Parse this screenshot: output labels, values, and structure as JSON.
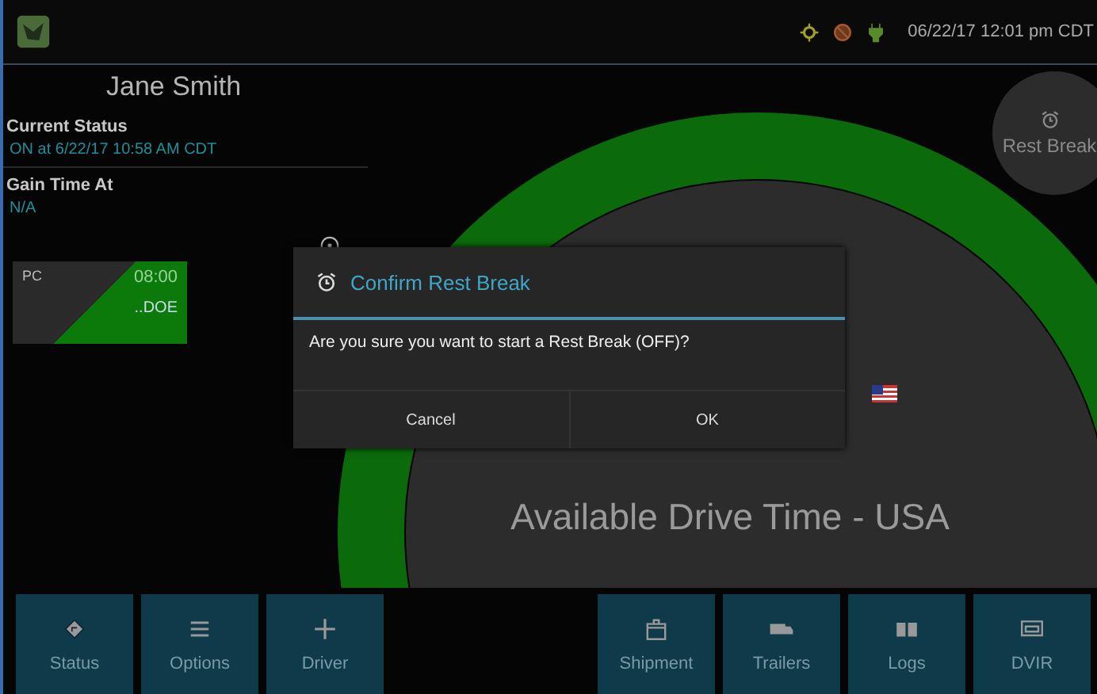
{
  "top_bar": {
    "datetime": "06/22/17 12:01 pm CDT"
  },
  "driver": {
    "name": "Jane Smith"
  },
  "current_status": {
    "label": "Current Status",
    "value": "ON at 6/22/17 10:58 AM CDT"
  },
  "gain_time": {
    "label": "Gain Time At",
    "value": "N/A"
  },
  "status_card": {
    "status": "PC",
    "time": "08:00",
    "driver": "..DOE"
  },
  "rest_break_button": {
    "label": "Rest Break"
  },
  "gauge": {
    "caption": "Available Drive Time - USA"
  },
  "dialog": {
    "title": "Confirm Rest Break",
    "message": "Are you sure you want to start a Rest Break (OFF)?",
    "buttons": [
      "Cancel",
      "OK"
    ]
  },
  "nav_left": [
    {
      "label": "Status"
    },
    {
      "label": "Options"
    },
    {
      "label": "Driver"
    }
  ],
  "nav_right": [
    {
      "label": "Shipment"
    },
    {
      "label": "Trailers"
    },
    {
      "label": "Logs"
    },
    {
      "label": "DVIR"
    }
  ]
}
